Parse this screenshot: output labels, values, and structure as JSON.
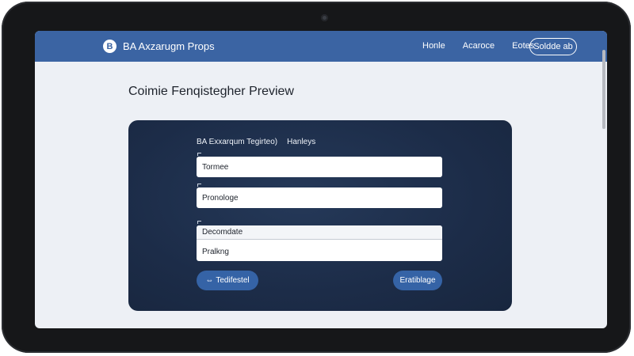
{
  "header": {
    "logo_letter": "B",
    "brand": "BA Axzarugm Props",
    "nav": [
      {
        "label": "Honle",
        "icon": "none"
      },
      {
        "label": "Acaroce"
      },
      {
        "label": "Eotes"
      }
    ],
    "cta_label": "Soldde ab"
  },
  "page": {
    "title": "Coimie Fenqistegher Preview"
  },
  "card": {
    "heading_left": "BA Exxarqum Tegirteo)",
    "heading_right": "Hanleys",
    "fields": [
      {
        "value": "Tormee"
      },
      {
        "value": "Pronologe"
      }
    ],
    "tall_field": {
      "head": "Decomdate",
      "body": "Pralkng"
    },
    "buttons": {
      "left_label": "Tedifestel",
      "left_icon": "link-icon",
      "right_label": "Eratiblage"
    }
  },
  "colors": {
    "topbar": "#3b64a3",
    "card": "#1c2c48",
    "button": "#3563a6",
    "screen": "#edf0f5"
  }
}
